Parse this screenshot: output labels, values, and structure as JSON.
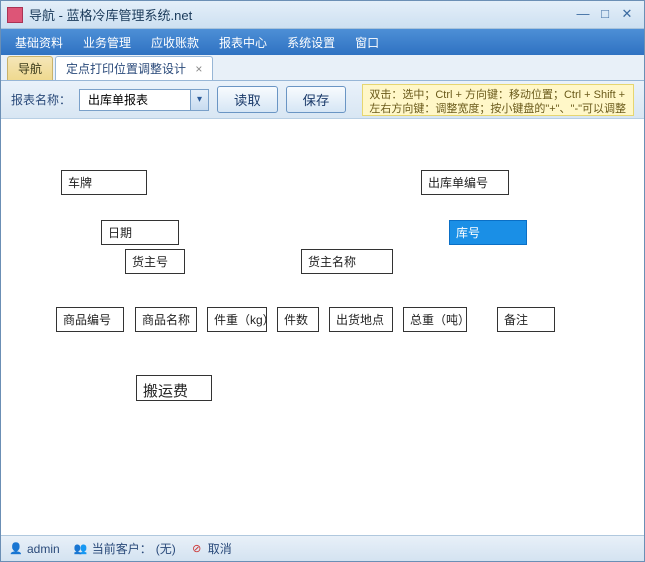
{
  "window": {
    "title": "导航 - 蓝格冷库管理系统.net"
  },
  "menu": {
    "items": [
      "基础资料",
      "业务管理",
      "应收账款",
      "报表中心",
      "系统设置",
      "窗口"
    ]
  },
  "tabs": {
    "items": [
      {
        "label": "导航",
        "closable": false
      },
      {
        "label": "定点打印位置调整设计",
        "closable": true
      }
    ],
    "active": 1
  },
  "toolbar": {
    "label_report_name": "报表名称：",
    "report_selected": "出库单报表",
    "btn_read": "读取",
    "btn_save": "保存",
    "hint": "双击：选中；Ctrl + 方向键：移动位置；Ctrl + Shift + 左右方向键：调整宽度；按小键盘的\"+\"、\"-\"可以调整字体的大小"
  },
  "fields": {
    "license_plate": "车牌",
    "outbound_no": "出库单编号",
    "date": "日期",
    "store_no": "库号",
    "owner_no": "货主号",
    "owner_name": "货主名称",
    "product_no": "商品编号",
    "product_name": "商品名称",
    "weight_kg": "件重（kg）",
    "pieces": "件数",
    "ship_location": "出货地点",
    "total_ton": "总重（吨）",
    "remark": "备注",
    "handling_fee": "搬运费"
  },
  "status": {
    "user": "admin",
    "current_customer_label": "当前客户：",
    "current_customer_value": "(无)",
    "cancel": "取消"
  },
  "colors": {
    "accent": "#2f72c2",
    "selection": "#1a8fe6",
    "hint_bg": "#fff7c8"
  }
}
